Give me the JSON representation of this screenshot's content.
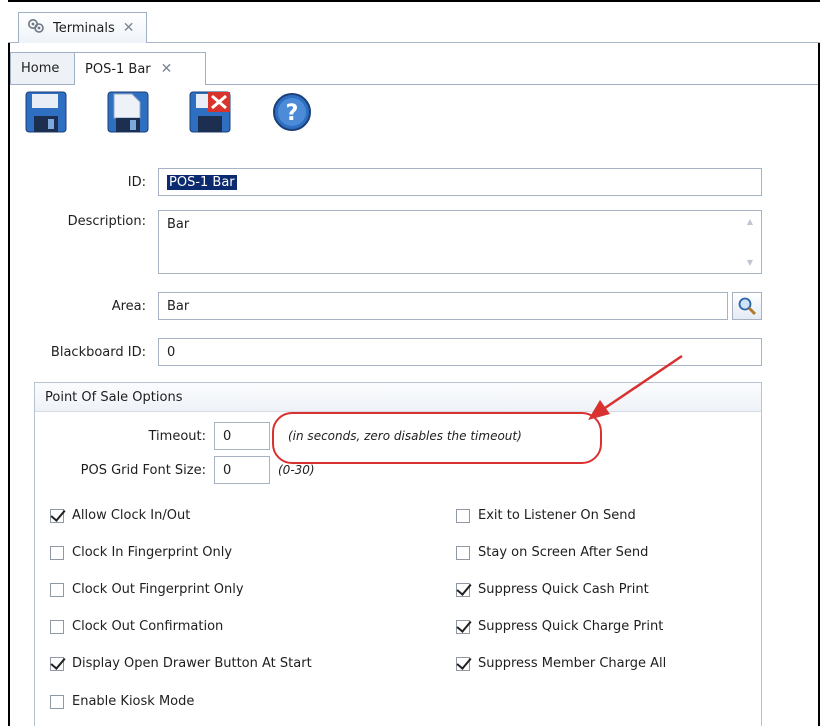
{
  "window": {
    "app_tab_label": "Terminals",
    "close_glyph": "✕",
    "doc_tabs": [
      {
        "label": "Home"
      },
      {
        "label": "POS-1 Bar"
      }
    ]
  },
  "toolbar": {
    "icons": [
      "save-icon",
      "save-as-icon",
      "delete-icon",
      "help-icon"
    ]
  },
  "form": {
    "id_label": "ID:",
    "id_value": "POS-1 Bar",
    "description_label": "Description:",
    "description_value": "Bar",
    "area_label": "Area:",
    "area_value": "Bar",
    "blackboard_label": "Blackboard ID:",
    "blackboard_value": "0"
  },
  "pos_options": {
    "title": "Point Of Sale Options",
    "timeout_label": "Timeout:",
    "timeout_value": "0",
    "timeout_hint": "(in seconds, zero disables the timeout)",
    "font_size_label": "POS Grid Font Size:",
    "font_size_value": "0",
    "font_size_hint": "(0-30)",
    "left_checks": [
      {
        "label": "Allow Clock In/Out",
        "checked": true
      },
      {
        "label": "Clock In Fingerprint Only",
        "checked": false
      },
      {
        "label": "Clock Out Fingerprint Only",
        "checked": false
      },
      {
        "label": "Clock Out Confirmation",
        "checked": false
      },
      {
        "label": "Display Open Drawer Button At Start",
        "checked": true
      },
      {
        "label": "Enable Kiosk Mode",
        "checked": false
      }
    ],
    "right_checks": [
      {
        "label": "Exit to Listener On Send",
        "checked": false
      },
      {
        "label": "Stay on Screen After Send",
        "checked": false
      },
      {
        "label": "Suppress Quick Cash Print",
        "checked": true
      },
      {
        "label": "Suppress Quick Charge Print",
        "checked": true
      },
      {
        "label": "Suppress Member Charge All",
        "checked": true
      }
    ]
  },
  "colors": {
    "annotation": "#d93030",
    "selection": "#0b2a6f"
  }
}
